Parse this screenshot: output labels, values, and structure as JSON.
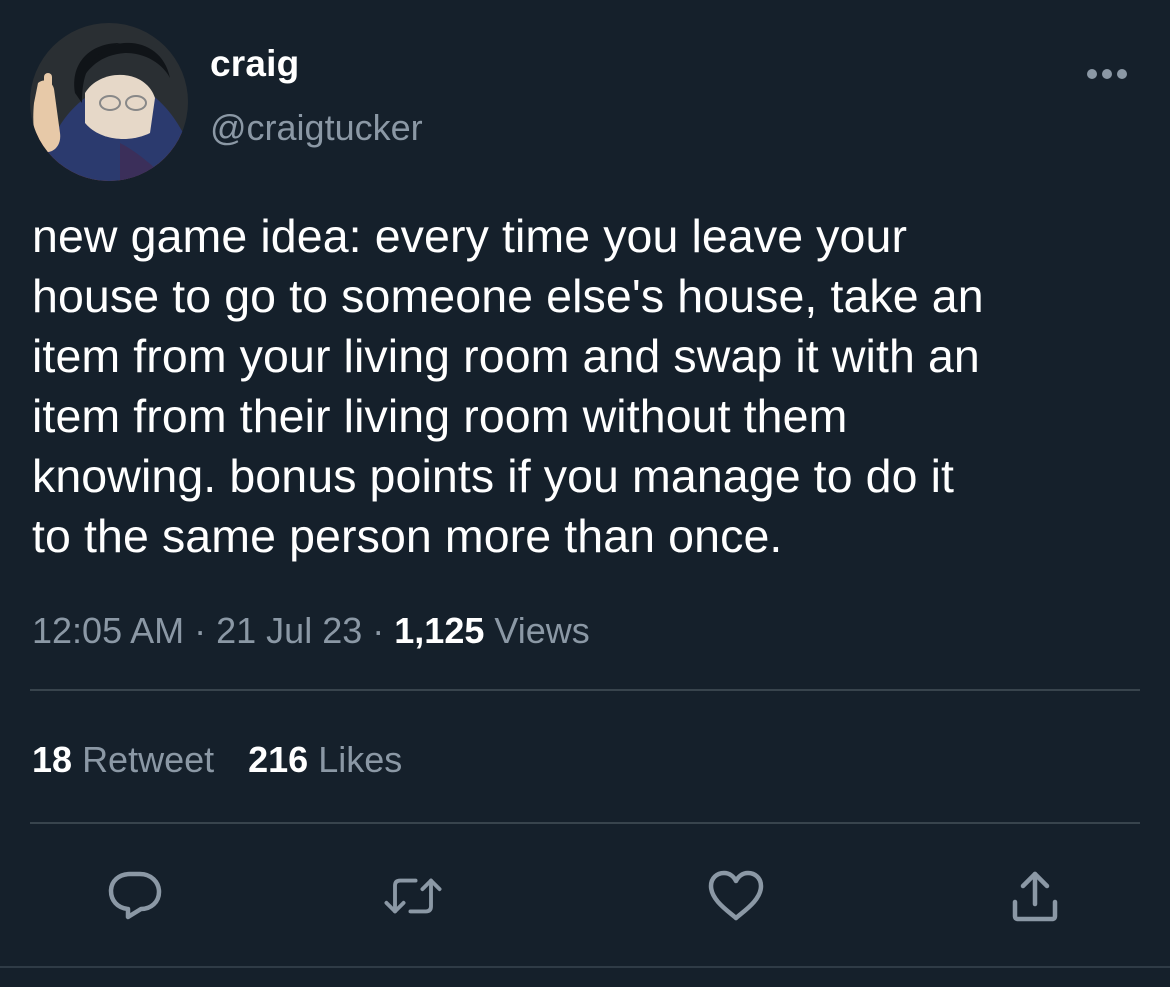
{
  "author": {
    "display_name": "craig",
    "handle": "@craigtucker"
  },
  "tweet": {
    "text": "new game idea: every time you leave your\nhouse to go to someone else's house, take an\nitem from your living room and swap it with an\nitem from their living room without them\nknowing. bonus points if you manage to do it\nto the same person more than once."
  },
  "meta": {
    "time": "12:05 AM",
    "separator": "·",
    "date": "21 Jul 23",
    "views_count": "1,125",
    "views_label": "Views"
  },
  "stats": {
    "retweets_count": "18",
    "retweets_label": "Retweet",
    "likes_count": "216",
    "likes_label": "Likes"
  },
  "icons": {
    "more": "more-horizontal-icon",
    "reply": "reply-bubble-icon",
    "retweet": "retweet-icon",
    "like": "heart-icon",
    "share": "share-icon"
  },
  "colors": {
    "background": "#15202b",
    "text_primary": "#ffffff",
    "text_secondary": "#8b98a5",
    "divider": "#38444d"
  }
}
